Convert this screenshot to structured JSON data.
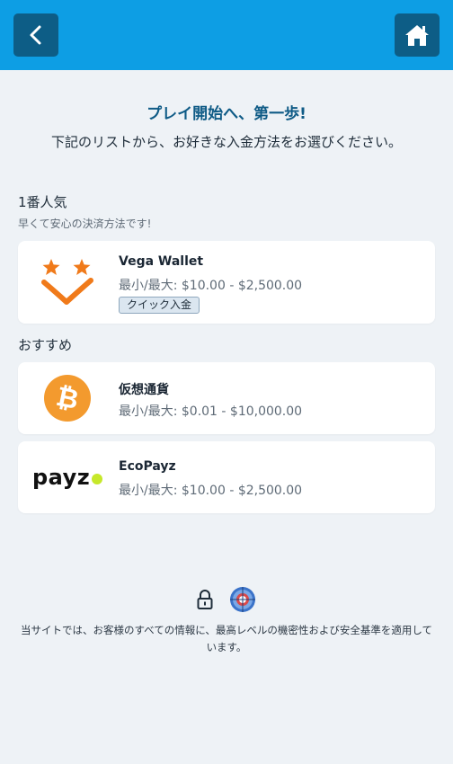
{
  "header": {
    "back_icon": "chevron-left-icon",
    "home_icon": "home-icon",
    "bar_color": "#0d9ee4",
    "button_color": "#0d5d86"
  },
  "intro": {
    "headline": "プレイ開始へ、第一歩!",
    "subhead": "下記のリストから、お好きな入金方法をお選びください。"
  },
  "popular": {
    "title": "1番人気",
    "subtitle": "早くて安心の決済方法です!",
    "methods": [
      {
        "name": "Vega Wallet",
        "range": "最小/最大: $10.00 - $2,500.00",
        "badge": "クイック入金",
        "icon": "vega-wallet-logo"
      }
    ]
  },
  "recommended": {
    "title": "おすすめ",
    "methods": [
      {
        "name": "仮想通貨",
        "range": "最小/最大: $0.01 - $10,000.00",
        "icon": "bitcoin-icon"
      },
      {
        "name": "EcoPayz",
        "range": "最小/最大: $10.00 - $2,500.00",
        "logo_text": "payz",
        "icon": "payz-logo"
      }
    ]
  },
  "footer": {
    "icons": [
      "lock-icon",
      "security-seal-icon"
    ],
    "text": "当サイトでは、お客様のすべての情報に、最高レベルの機密性および安全基準を適用しています。"
  }
}
